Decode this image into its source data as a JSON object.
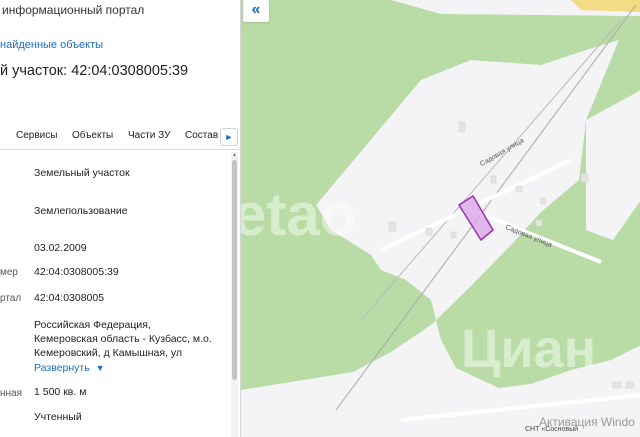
{
  "panel": {
    "portal_title": "информационный портал",
    "found_objects_link": "найденные объекты",
    "object_title": "й участок: 42:04:0308005:39",
    "tabs": [
      "Сервисы",
      "Объекты",
      "Части ЗУ",
      "Состав"
    ],
    "tab_next": "►",
    "rows": [
      {
        "label": "",
        "value": "Земельный участок"
      },
      {
        "label": "",
        "value": "Землепользование"
      },
      {
        "label": "​",
        "value": "03.02.2009"
      },
      {
        "label": "мер",
        "value": "42:04:0308005:39"
      },
      {
        "label": "ртал",
        "value": "42:04:0308005"
      },
      {
        "label": "",
        "value_lines": [
          "Российская Федерация,",
          "Кемеровская область - Кузбасс, м.о.",
          "Кемеровский, д Камышная, ул"
        ]
      },
      {
        "label": "нная",
        "value": "1 500 кв. м"
      },
      {
        "label": "",
        "value": "Учтенный"
      }
    ],
    "expand_link": "Развернуть"
  },
  "map": {
    "collapse_button": "«",
    "street_top": "Садовая улица",
    "street_bottom": "Садовая улица",
    "snt_label": "СНТ «Сосновый",
    "activation_text": "Активация Windo",
    "watermark_1": "etao",
    "watermark_2": "Циан",
    "colors": {
      "green": "#b9dca6",
      "clearing": "#f4f4f6",
      "building": "#e4e4e6",
      "parcel_fill": "#d9a7e6",
      "parcel_stroke": "#a12ab8",
      "road_yellow": "#f3dc84"
    }
  }
}
